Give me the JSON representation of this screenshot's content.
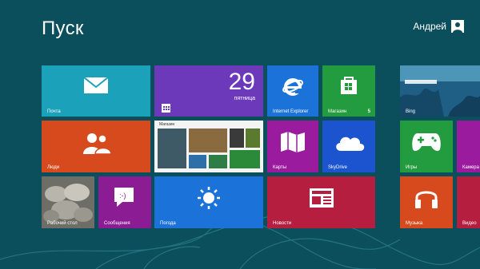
{
  "start": {
    "title": "Пуск"
  },
  "user": {
    "name": "Андрей",
    "avatar_icon": "user-avatar-icon"
  },
  "colors": {
    "background": "#0b4f5c",
    "mail": "#1ba1b9",
    "calendar": "#6c39ba",
    "ie": "#1b73d9",
    "store": "#229c3f",
    "people": "#d74a1e",
    "maps": "#9a1b9d",
    "skydrive": "#1c53cf",
    "games": "#229c3f",
    "messaging": "#8b1c93",
    "weather": "#1b73d9",
    "news": "#b51e3f",
    "music": "#d74a1e",
    "video": "#b51e3f",
    "camera": "#9a1b9d"
  },
  "tiles": {
    "mail": {
      "label": "Почта",
      "icon": "mail-icon"
    },
    "calendar": {
      "day": "29",
      "weekday": "пятница",
      "icon": "calendar-icon"
    },
    "ie": {
      "label": "Internet Explorer",
      "icon": "internet-explorer-icon"
    },
    "store": {
      "label": "Магазин",
      "count": "5",
      "icon": "store-bag-icon"
    },
    "bing": {
      "label": "Bing"
    },
    "people": {
      "label": "Люди",
      "icon": "people-icon"
    },
    "store_preview": {
      "title": "Магазин"
    },
    "maps": {
      "label": "Карты",
      "icon": "maps-icon"
    },
    "skydrive": {
      "label": "SkyDrive",
      "icon": "cloud-icon"
    },
    "games": {
      "label": "Игры",
      "icon": "gamepad-icon"
    },
    "camera": {
      "label": "Камера"
    },
    "photos": {
      "label": "Рабочий стол"
    },
    "messaging": {
      "label": "Сообщения",
      "icon": "chat-smiley-icon"
    },
    "weather": {
      "label": "Погода",
      "icon": "sun-icon"
    },
    "news": {
      "label": "Новости",
      "icon": "newspaper-icon"
    },
    "music": {
      "label": "Музыка",
      "icon": "headphones-icon"
    },
    "video": {
      "label": "Видео"
    }
  }
}
